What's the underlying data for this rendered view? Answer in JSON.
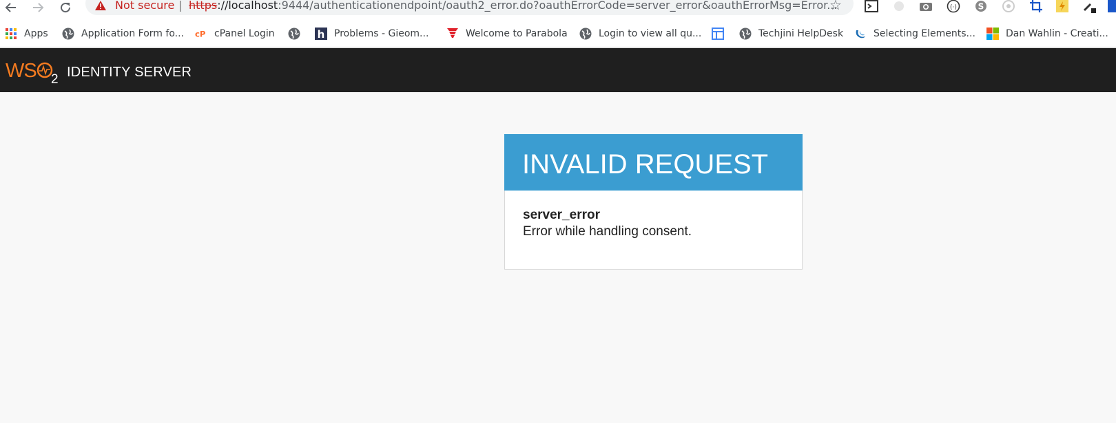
{
  "browser": {
    "security_label": "Not secure",
    "separator": "|",
    "url_scheme": "https",
    "url_host": "://localhost",
    "url_rest": ":9444/authenticationendpoint/oauth2_error.do?oauthErrorCode=server_error&oauthErrorMsg=Error...",
    "bookmarks": [
      {
        "label": "Apps",
        "icon": "apps-grid-icon"
      },
      {
        "label": "Application Form fo...",
        "icon": "globe-icon"
      },
      {
        "label": "cPanel Login",
        "icon": "cpanel-icon"
      },
      {
        "label": "",
        "icon": "globe-icon"
      },
      {
        "label": "Problems - Gieom...",
        "icon": "hackerrank-icon"
      },
      {
        "label": "Welcome to Parabola",
        "icon": "tornado-icon"
      },
      {
        "label": "Login to view all qu...",
        "icon": "globe-icon"
      },
      {
        "label": "",
        "icon": "layout-icon"
      },
      {
        "label": "Techjini HelpDesk",
        "icon": "globe-icon"
      },
      {
        "label": "Selecting Elements...",
        "icon": "jquery-icon"
      },
      {
        "label": "Dan Wahlin - Creati...",
        "icon": "microsoft-icon"
      }
    ]
  },
  "header": {
    "logo_text": "WSO2",
    "title": "IDENTITY SERVER"
  },
  "error_card": {
    "title": "INVALID REQUEST",
    "code": "server_error",
    "message": "Error while handling consent."
  },
  "colors": {
    "header_bg": "#1f1f1f",
    "card_header_bg": "#3b9dd1",
    "logo_orange": "#f47b20",
    "insecure_red": "#c5221f"
  }
}
